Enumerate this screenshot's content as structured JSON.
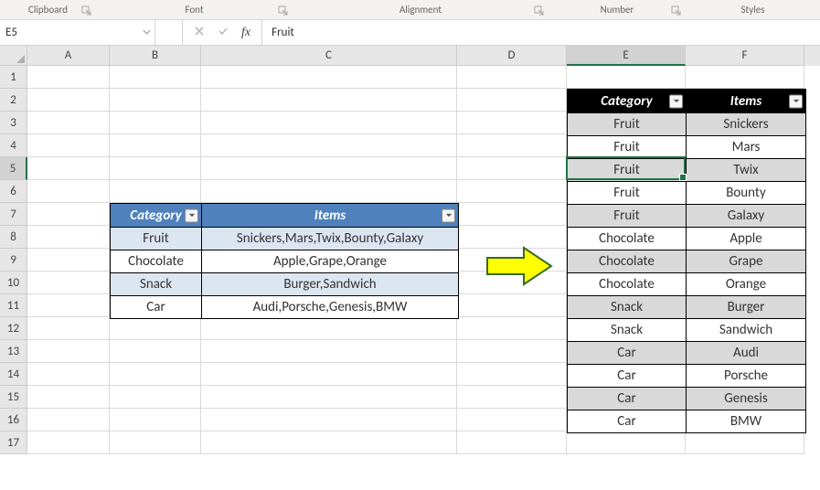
{
  "ribbon_groups": {
    "clipboard": "Clipboard",
    "font": "Font",
    "alignment": "Alignment",
    "number": "Number",
    "styles": "Styles"
  },
  "name_box": "E5",
  "formula_bar": "Fruit",
  "columns": [
    "A",
    "B",
    "C",
    "D",
    "E",
    "F"
  ],
  "row_count": 17,
  "active_col_index": 4,
  "active_row_index": 4,
  "table_left": {
    "headers": {
      "category": "Category",
      "items": "Items"
    },
    "rows": [
      {
        "category": "Fruit",
        "items": "Snickers,Mars,Twix,Bounty,Galaxy"
      },
      {
        "category": "Chocolate",
        "items": "Apple,Grape,Orange"
      },
      {
        "category": "Snack",
        "items": "Burger,Sandwich"
      },
      {
        "category": "Car",
        "items": "Audi,Porsche,Genesis,BMW"
      }
    ]
  },
  "table_right": {
    "headers": {
      "category": "Category",
      "items": "Items"
    },
    "rows": [
      {
        "category": "Fruit",
        "items": "Snickers"
      },
      {
        "category": "Fruit",
        "items": "Mars"
      },
      {
        "category": "Fruit",
        "items": "Twix"
      },
      {
        "category": "Fruit",
        "items": "Bounty"
      },
      {
        "category": "Fruit",
        "items": "Galaxy"
      },
      {
        "category": "Chocolate",
        "items": "Apple"
      },
      {
        "category": "Chocolate",
        "items": "Grape"
      },
      {
        "category": "Chocolate",
        "items": "Orange"
      },
      {
        "category": "Snack",
        "items": "Burger"
      },
      {
        "category": "Snack",
        "items": "Sandwich"
      },
      {
        "category": "Car",
        "items": "Audi"
      },
      {
        "category": "Car",
        "items": "Porsche"
      },
      {
        "category": "Car",
        "items": "Genesis"
      },
      {
        "category": "Car",
        "items": "BMW"
      }
    ]
  }
}
